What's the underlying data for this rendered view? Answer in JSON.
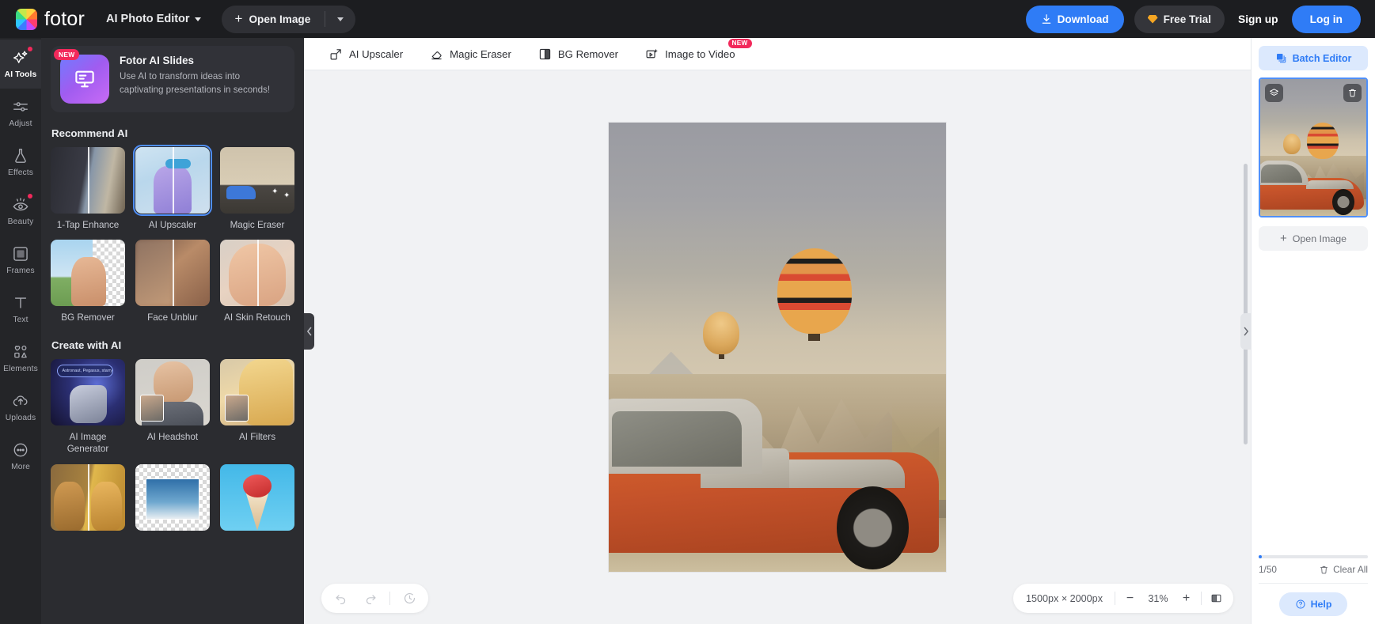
{
  "topbar": {
    "brand_name": "fotor",
    "app_switcher": "AI Photo Editor",
    "open_image": "Open Image",
    "download": "Download",
    "free_trial": "Free Trial",
    "sign_up": "Sign up",
    "log_in": "Log in",
    "accent_blue": "#2f7cf6",
    "badge_pink": "#f2295b"
  },
  "rail": [
    {
      "label": "AI Tools",
      "icon": "sparkle-icon",
      "active": true,
      "dot": true
    },
    {
      "label": "Adjust",
      "icon": "sliders-icon",
      "active": false,
      "dot": false
    },
    {
      "label": "Effects",
      "icon": "flask-icon",
      "active": false,
      "dot": false
    },
    {
      "label": "Beauty",
      "icon": "eye-icon",
      "active": false,
      "dot": true
    },
    {
      "label": "Frames",
      "icon": "frame-icon",
      "active": false,
      "dot": false
    },
    {
      "label": "Text",
      "icon": "text-icon",
      "active": false,
      "dot": false
    },
    {
      "label": "Elements",
      "icon": "shapes-icon",
      "active": false,
      "dot": false
    },
    {
      "label": "Uploads",
      "icon": "upload-cloud-icon",
      "active": false,
      "dot": false
    },
    {
      "label": "More",
      "icon": "ellipsis-icon",
      "active": false,
      "dot": false
    }
  ],
  "promo": {
    "badge": "NEW",
    "title": "Fotor AI Slides",
    "description": "Use AI to transform ideas into captivating presentations in seconds!"
  },
  "sections": [
    {
      "heading": "Recommend AI",
      "tiles": [
        {
          "label": "1-Tap Enhance",
          "selected": false
        },
        {
          "label": "AI Upscaler",
          "selected": true
        },
        {
          "label": "Magic Eraser",
          "selected": false
        },
        {
          "label": "BG Remover",
          "selected": false
        },
        {
          "label": "Face Unblur",
          "selected": false
        },
        {
          "label": "AI Skin Retouch",
          "selected": false
        }
      ]
    },
    {
      "heading": "Create with AI",
      "tiles": [
        {
          "label": "AI Image Generator",
          "selected": false
        },
        {
          "label": "AI Headshot",
          "selected": false
        },
        {
          "label": "AI Filters",
          "selected": false
        }
      ]
    }
  ],
  "astro_prompt": "Astronaut, Pegasus, starry ...",
  "canvas_toolbar": [
    {
      "label": "AI Upscaler",
      "icon": "upscale-icon",
      "badge": ""
    },
    {
      "label": "Magic Eraser",
      "icon": "eraser-icon",
      "badge": ""
    },
    {
      "label": "BG Remover",
      "icon": "bg-remove-icon",
      "badge": ""
    },
    {
      "label": "Image to Video",
      "icon": "image-to-video-icon",
      "badge": "NEW"
    }
  ],
  "statusbar": {
    "dimensions": "1500px × 2000px",
    "zoom": "31%",
    "zoom_out": "−",
    "zoom_in": "+",
    "compare_icon": "compare-split-icon",
    "undo_icon": "undo-icon",
    "redo_icon": "redo-icon",
    "history_icon": "history-icon"
  },
  "right_panel": {
    "batch_editor": "Batch Editor",
    "open_image": "Open Image",
    "counter": "1/50",
    "clear_all": "Clear All",
    "help": "Help",
    "layers_icon": "layers-icon",
    "delete_icon": "trash-icon"
  }
}
